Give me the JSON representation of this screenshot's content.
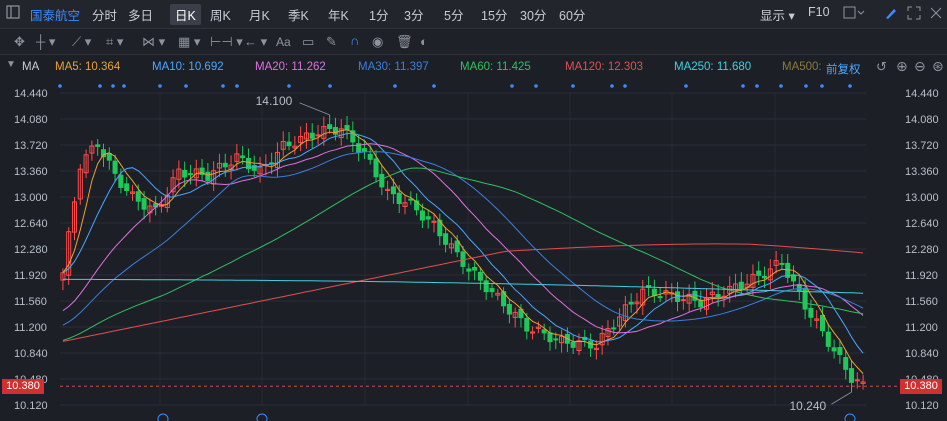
{
  "topbar": {
    "brand": "国泰航空",
    "periods": [
      "分时",
      "多日",
      "日K",
      "周K",
      "月K",
      "季K",
      "年K",
      "1分",
      "3分",
      "5分",
      "15分",
      "30分",
      "60分"
    ],
    "active_period": "日K",
    "display_label": "显示",
    "f10_label": "F10"
  },
  "toolbar": {
    "aa_label": "Aa"
  },
  "ma_bar": {
    "prefix": "MA",
    "items": [
      {
        "label": "MA5: 10.364",
        "color": "#f0a030"
      },
      {
        "label": "MA10: 10.692",
        "color": "#4aa8ff"
      },
      {
        "label": "MA20: 11.262",
        "color": "#e070e0"
      },
      {
        "label": "MA30: 11.397",
        "color": "#3b7fe0"
      },
      {
        "label": "MA60: 11.425",
        "color": "#30c060"
      },
      {
        "label": "MA120: 12.303",
        "color": "#e05050"
      },
      {
        "label": "MA250: 11.680",
        "color": "#40d0e0"
      },
      {
        "label": "MA500:",
        "color": "#8a7a40"
      }
    ],
    "adjust_label": "前复权"
  },
  "price_tag": "10.380",
  "chart_data": {
    "type": "candlestick",
    "y_ticks": [
      "14.440",
      "14.080",
      "13.720",
      "13.360",
      "13.000",
      "12.640",
      "12.280",
      "11.920",
      "11.560",
      "11.200",
      "10.840",
      "10.480",
      "10.120"
    ],
    "ylim": [
      10.12,
      14.44
    ],
    "high_label": "14.100",
    "low_label": "10.240",
    "current_price": 10.38,
    "up_color": "#ff4a4a",
    "down_color": "#1ec85a"
  }
}
